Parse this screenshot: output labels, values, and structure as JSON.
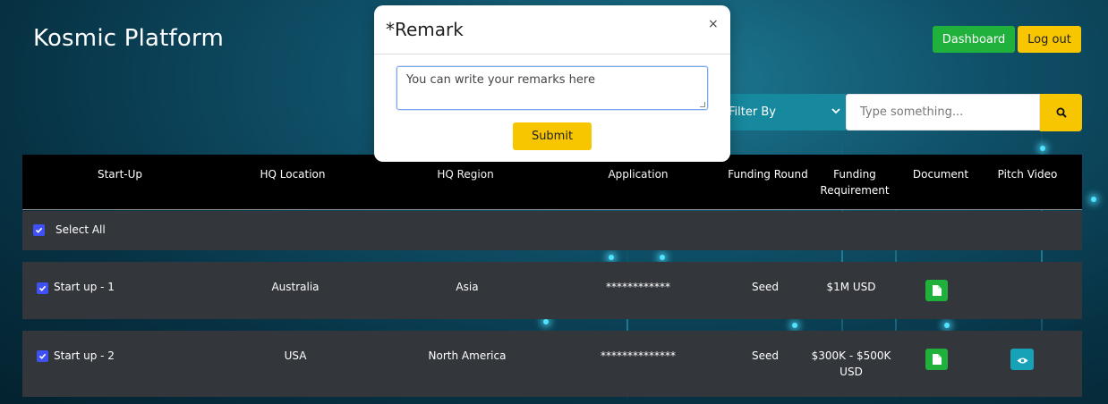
{
  "app": {
    "brand": "Kosmic Platform"
  },
  "header": {
    "dashboard_label": "Dashboard",
    "logout_label": "Log out"
  },
  "filters": {
    "filter_by_label": "Filter By",
    "search_placeholder": "Type something..."
  },
  "table": {
    "headers": {
      "startup": "Start-Up",
      "hq_location": "HQ Location",
      "hq_region": "HQ Region",
      "application": "Application",
      "funding_round": "Funding Round",
      "funding_requirement_1": "Funding",
      "funding_requirement_2": "Requirement",
      "document": "Document",
      "pitch_video": "Pitch Video"
    },
    "select_all_label": "Select All",
    "rows": [
      {
        "name": "Start up - 1",
        "location": "Australia",
        "region": "Asia",
        "application": "************",
        "round": "Seed",
        "requirement_1": "$1M USD",
        "requirement_2": "",
        "has_video": false
      },
      {
        "name": "Start up - 2",
        "location": "USA",
        "region": "North America",
        "application": "**************",
        "round": "Seed",
        "requirement_1": "$300K - $500K",
        "requirement_2": "USD",
        "has_video": true
      }
    ]
  },
  "modal": {
    "title": "*Remark",
    "close_glyph": "×",
    "textarea_placeholder": "You can write your remarks here",
    "submit_label": "Submit"
  },
  "colors": {
    "primary_green": "#1fb13c",
    "accent_yellow": "#f7c600",
    "teal": "#17899f",
    "checkbox_blue": "#3f51f5"
  }
}
